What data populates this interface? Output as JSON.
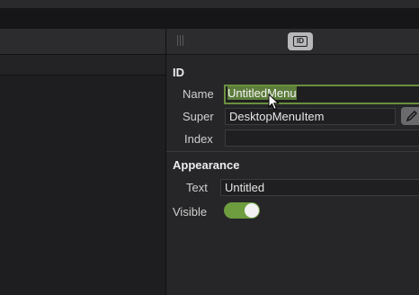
{
  "inspector": {
    "id_section": "ID",
    "name_label": "Name",
    "name_value": "UntitledMenu",
    "super_label": "Super",
    "super_value": "DesktopMenuItem",
    "index_label": "Index",
    "index_value": "",
    "appearance_section": "Appearance",
    "text_label": "Text",
    "text_value": "Untitled",
    "visible_label": "Visible",
    "visible_on": true
  },
  "colors": {
    "accent": "#6d9d3f",
    "focus_border": "#6a8f3e",
    "selection": "#5d7d3c"
  },
  "icons": [
    "inspector-id-icon",
    "pencil-icon",
    "grip-icon",
    "mouse-cursor-icon"
  ]
}
